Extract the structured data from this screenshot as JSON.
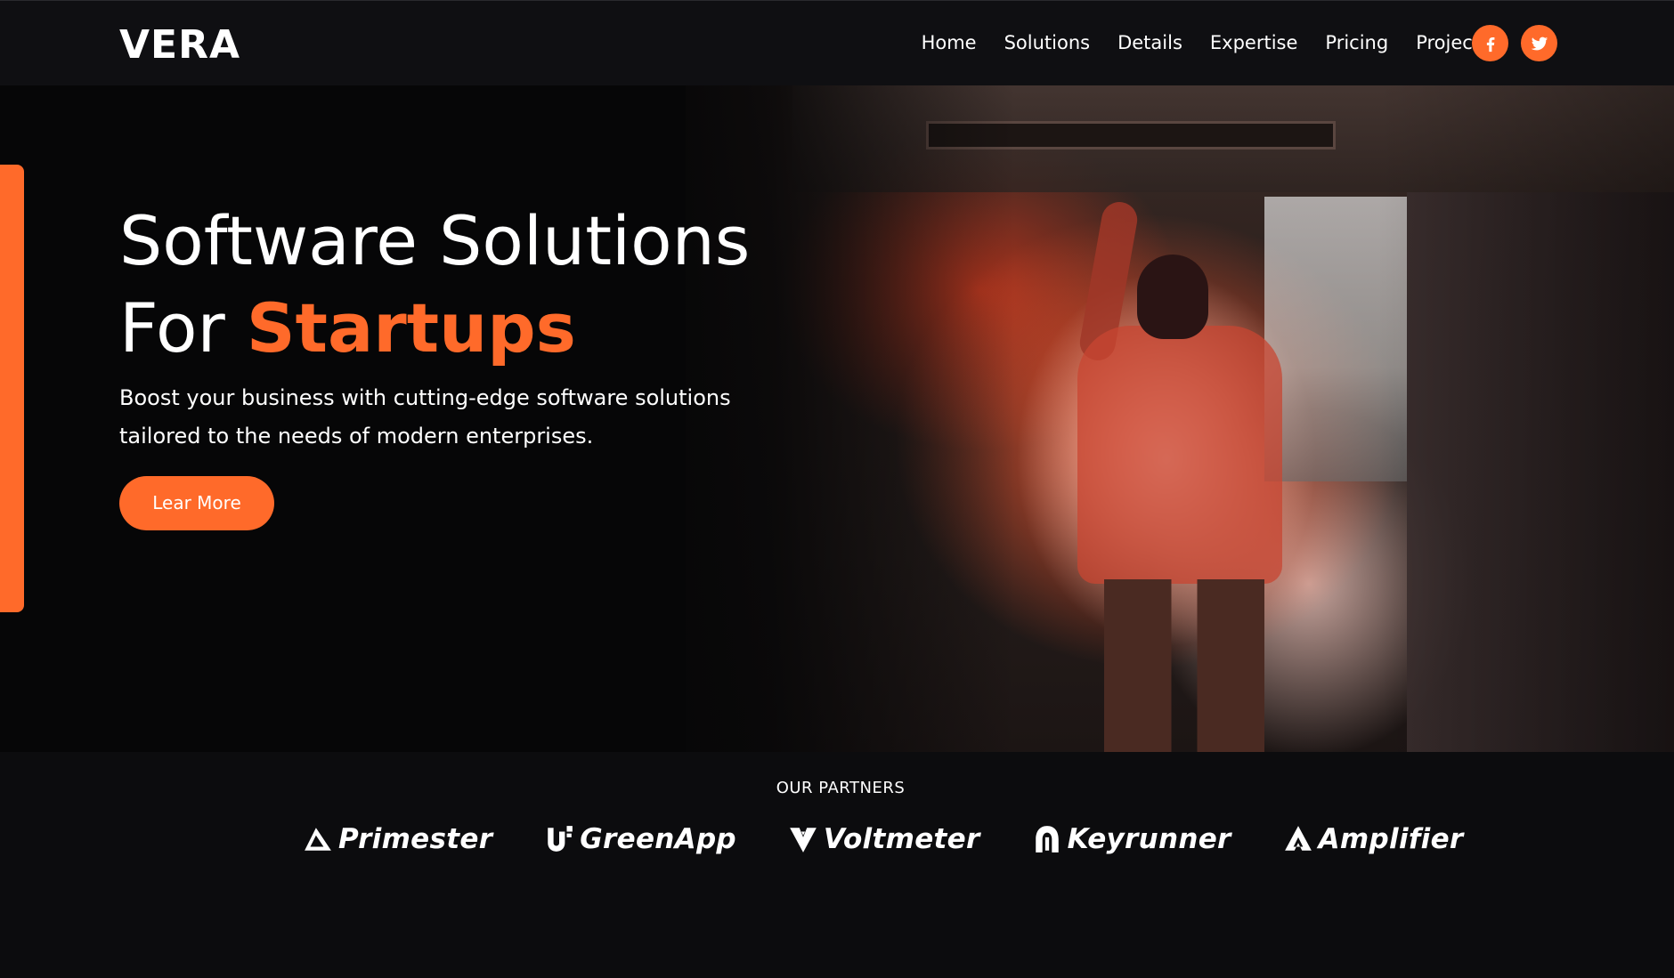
{
  "brand": {
    "logo_text": "VERA"
  },
  "nav": {
    "links": [
      "Home",
      "Solutions",
      "Details",
      "Expertise",
      "Pricing",
      "Projects"
    ],
    "socials": [
      {
        "icon": "facebook-icon"
      },
      {
        "icon": "twitter-icon"
      }
    ]
  },
  "hero": {
    "title_line1": "Software Solutions",
    "title_line2_prefix": "For ",
    "title_line2_accent": "Startups",
    "subtitle": "Boost your business with cutting-edge software solutions tailored to the needs of modern enterprises.",
    "cta_label": "Lear More"
  },
  "partners": {
    "title": "OUR PARTNERS",
    "items": [
      {
        "name": "Primester",
        "icon": "primester-logo-icon"
      },
      {
        "name": "GreenApp",
        "icon": "greenapp-logo-icon"
      },
      {
        "name": "Voltmeter",
        "icon": "voltmeter-logo-icon"
      },
      {
        "name": "Keyrunner",
        "icon": "keyrunner-logo-icon"
      },
      {
        "name": "Amplifier",
        "icon": "amplifier-logo-icon"
      }
    ]
  },
  "colors": {
    "accent": "#ff6a2a",
    "background": "#0c0c0e",
    "hero_background": "#060607"
  }
}
